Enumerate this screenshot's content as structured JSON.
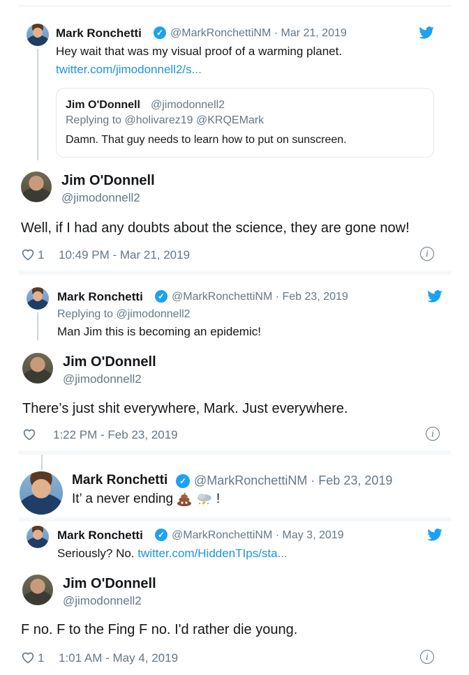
{
  "tweet1": {
    "name": "Mark Ronchetti",
    "handle": "@MarkRonchettiNM · Mar 21, 2019",
    "line1": "Hey wait that was my visual proof of a warming planet.",
    "link": "twitter.com/jimodonnell2/s...",
    "quote": {
      "name": "Jim O'Donnell",
      "handle": "@jimodonnell2",
      "replying": "Replying to @holivarez19 @KRQEMark",
      "text": "Damn. That guy needs to learn how to put on sunscreen."
    },
    "reply": {
      "name": "Jim O'Donnell",
      "handle": "@jimodonnell2",
      "text": "Well, if I had any doubts about the science, they are gone now!",
      "likes": "1",
      "timestamp": "10:49 PM - Mar 21, 2019"
    }
  },
  "tweet2": {
    "name": "Mark Ronchetti",
    "handle": "@MarkRonchettiNM · Feb 23, 2019",
    "replying": "Replying to @jimodonnell2",
    "text": "Man Jim this is becoming an epidemic!",
    "reply": {
      "name": "Jim O'Donnell",
      "handle": "@jimodonnell2",
      "text": "There’s just shit everywhere, Mark. Just everywhere.",
      "timestamp": "1:22 PM - Feb 23, 2019"
    }
  },
  "tweet3": {
    "name": "Mark Ronchetti",
    "handle": "@MarkRonchettiNM · Feb 23, 2019",
    "text_prefix": "It’ a never ending",
    "text_suffix": "!"
  },
  "tweet4": {
    "name": "Mark Ronchetti",
    "handle": "@MarkRonchettiNM · May 3, 2019",
    "text_prefix": "Seriously?  No.",
    "link": "twitter.com/HiddenTIps/sta...",
    "reply": {
      "name": "Jim O'Donnell",
      "handle": "@jimodonnell2",
      "text": "F no. F to the Fing F no. I'd rather die young.",
      "likes": "1",
      "timestamp": "1:01 AM - May 4, 2019"
    }
  },
  "icons": {
    "verified": "verified-badge-icon",
    "bird": "twitter-bird-icon",
    "heart": "heart-outline-icon",
    "info": "info-icon",
    "poop": "pile-of-poo-emoji",
    "storm": "thunder-cloud-emoji"
  },
  "colors": {
    "link": "#1b95e0",
    "muted": "#657786",
    "verified": "#1da1f2"
  }
}
